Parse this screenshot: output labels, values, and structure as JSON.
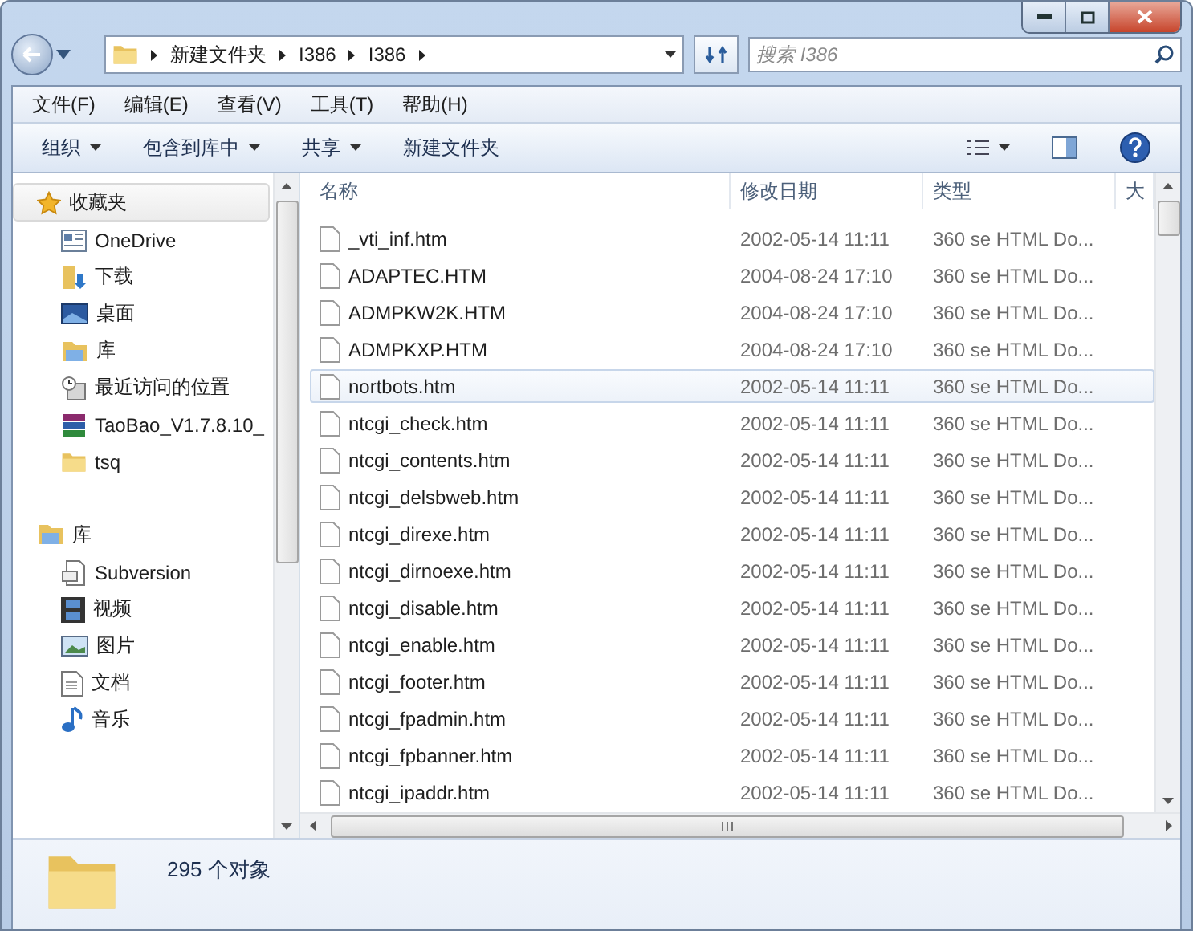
{
  "address": {
    "crumbs": [
      "新建文件夹",
      "I386",
      "I386"
    ],
    "search_placeholder": "搜索 I386"
  },
  "menu": [
    "文件(F)",
    "编辑(E)",
    "查看(V)",
    "工具(T)",
    "帮助(H)"
  ],
  "toolbar": [
    {
      "label": "组织",
      "dropdown": true
    },
    {
      "label": "包含到库中",
      "dropdown": true
    },
    {
      "label": "共享",
      "dropdown": true
    },
    {
      "label": "新建文件夹",
      "dropdown": false
    }
  ],
  "sidebar": {
    "groups": [
      {
        "label": "收藏夹",
        "selected": true,
        "items": [
          "OneDrive",
          "下载",
          "桌面",
          "库",
          "最近访问的位置",
          "TaoBao_V1.7.8.10_",
          "tsq"
        ]
      },
      {
        "label": "库",
        "selected": false,
        "items": [
          "Subversion",
          "视频",
          "图片",
          "文档",
          "音乐"
        ]
      }
    ]
  },
  "table": {
    "columns": [
      "名称",
      "修改日期",
      "类型",
      "大"
    ],
    "rows": [
      {
        "name": "_vti_inf.htm",
        "date": "2002-05-14 11:11",
        "type": "360 se HTML Do...",
        "selected": false
      },
      {
        "name": "ADAPTEC.HTM",
        "date": "2004-08-24 17:10",
        "type": "360 se HTML Do...",
        "selected": false
      },
      {
        "name": "ADMPKW2K.HTM",
        "date": "2004-08-24 17:10",
        "type": "360 se HTML Do...",
        "selected": false
      },
      {
        "name": "ADMPKXP.HTM",
        "date": "2004-08-24 17:10",
        "type": "360 se HTML Do...",
        "selected": false
      },
      {
        "name": "nortbots.htm",
        "date": "2002-05-14 11:11",
        "type": "360 se HTML Do...",
        "selected": true
      },
      {
        "name": "ntcgi_check.htm",
        "date": "2002-05-14 11:11",
        "type": "360 se HTML Do...",
        "selected": false
      },
      {
        "name": "ntcgi_contents.htm",
        "date": "2002-05-14 11:11",
        "type": "360 se HTML Do...",
        "selected": false
      },
      {
        "name": "ntcgi_delsbweb.htm",
        "date": "2002-05-14 11:11",
        "type": "360 se HTML Do...",
        "selected": false
      },
      {
        "name": "ntcgi_direxe.htm",
        "date": "2002-05-14 11:11",
        "type": "360 se HTML Do...",
        "selected": false
      },
      {
        "name": "ntcgi_dirnoexe.htm",
        "date": "2002-05-14 11:11",
        "type": "360 se HTML Do...",
        "selected": false
      },
      {
        "name": "ntcgi_disable.htm",
        "date": "2002-05-14 11:11",
        "type": "360 se HTML Do...",
        "selected": false
      },
      {
        "name": "ntcgi_enable.htm",
        "date": "2002-05-14 11:11",
        "type": "360 se HTML Do...",
        "selected": false
      },
      {
        "name": "ntcgi_footer.htm",
        "date": "2002-05-14 11:11",
        "type": "360 se HTML Do...",
        "selected": false
      },
      {
        "name": "ntcgi_fpadmin.htm",
        "date": "2002-05-14 11:11",
        "type": "360 se HTML Do...",
        "selected": false
      },
      {
        "name": "ntcgi_fpbanner.htm",
        "date": "2002-05-14 11:11",
        "type": "360 se HTML Do...",
        "selected": false
      },
      {
        "name": "ntcgi_ipaddr.htm",
        "date": "2002-05-14 11:11",
        "type": "360 se HTML Do...",
        "selected": false
      }
    ]
  },
  "status_bar": {
    "count": "295 个对象"
  }
}
